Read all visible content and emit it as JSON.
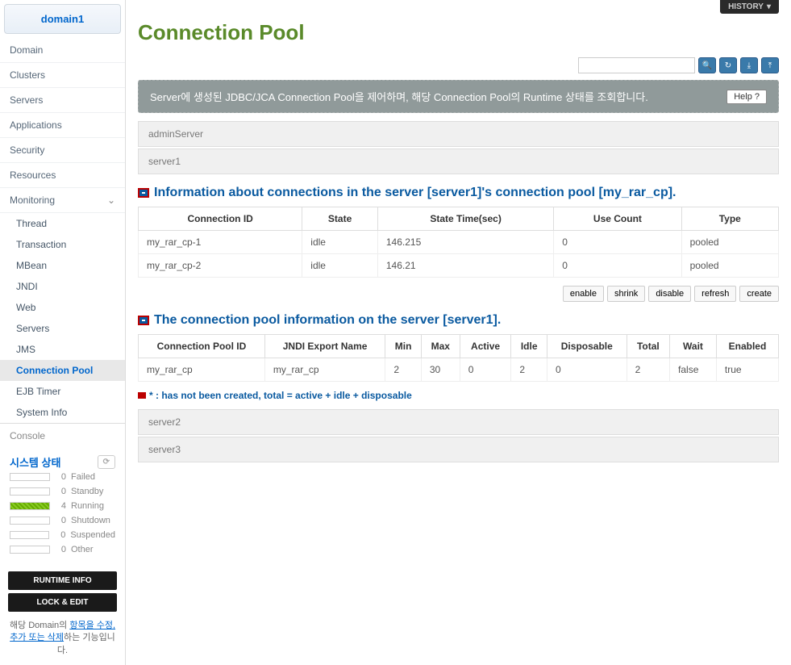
{
  "sidebar": {
    "domain_name": "domain1",
    "nav": [
      "Domain",
      "Clusters",
      "Servers",
      "Applications",
      "Security",
      "Resources"
    ],
    "monitoring_label": "Monitoring",
    "monitoring_items": [
      "Thread",
      "Transaction",
      "MBean",
      "JNDI",
      "Web",
      "Servers",
      "JMS",
      "Connection Pool",
      "EJB Timer",
      "System Info"
    ],
    "console_label": "Console",
    "system_status_title": "시스템 상태",
    "statuses": [
      {
        "count": "0",
        "label": "Failed",
        "running": false
      },
      {
        "count": "0",
        "label": "Standby",
        "running": false
      },
      {
        "count": "4",
        "label": "Running",
        "running": true
      },
      {
        "count": "0",
        "label": "Shutdown",
        "running": false
      },
      {
        "count": "0",
        "label": "Suspended",
        "running": false
      },
      {
        "count": "0",
        "label": "Other",
        "running": false
      }
    ],
    "runtime_btn": "RUNTIME INFO",
    "lock_btn": "LOCK & EDIT",
    "note_prefix": "해당 Domain의 ",
    "note_link": "항목을 수정, 추가 또는 삭제",
    "note_suffix": "하는 기능입니다."
  },
  "main": {
    "history_btn": "HISTORY",
    "title": "Connection Pool",
    "search_placeholder": "",
    "description": "Server에 생성된 JDBC/JCA Connection Pool을 제어하며, 해당 Connection Pool의 Runtime 상태를 조회합니다.",
    "help_label": "Help",
    "servers_top": [
      "adminServer",
      "server1"
    ],
    "section1_title": "Information about connections in the server [server1]'s connection pool [my_rar_cp].",
    "table1": {
      "headers": [
        "Connection ID",
        "State",
        "State Time(sec)",
        "Use Count",
        "Type"
      ],
      "rows": [
        [
          "my_rar_cp-1",
          "idle",
          "146.215",
          "0",
          "pooled"
        ],
        [
          "my_rar_cp-2",
          "idle",
          "146.21",
          "0",
          "pooled"
        ]
      ]
    },
    "actions": [
      "enable",
      "shrink",
      "disable",
      "refresh",
      "create"
    ],
    "section2_title": "The connection pool information on the server [server1].",
    "table2": {
      "headers": [
        "Connection Pool ID",
        "JNDI Export Name",
        "Min",
        "Max",
        "Active",
        "Idle",
        "Disposable",
        "Total",
        "Wait",
        "Enabled"
      ],
      "rows": [
        [
          "my_rar_cp",
          "my_rar_cp",
          "2",
          "30",
          "0",
          "2",
          "0",
          "2",
          "false",
          "true"
        ]
      ]
    },
    "footnote": "* : has not been created, total = active + idle + disposable",
    "servers_bottom": [
      "server2",
      "server3"
    ]
  }
}
